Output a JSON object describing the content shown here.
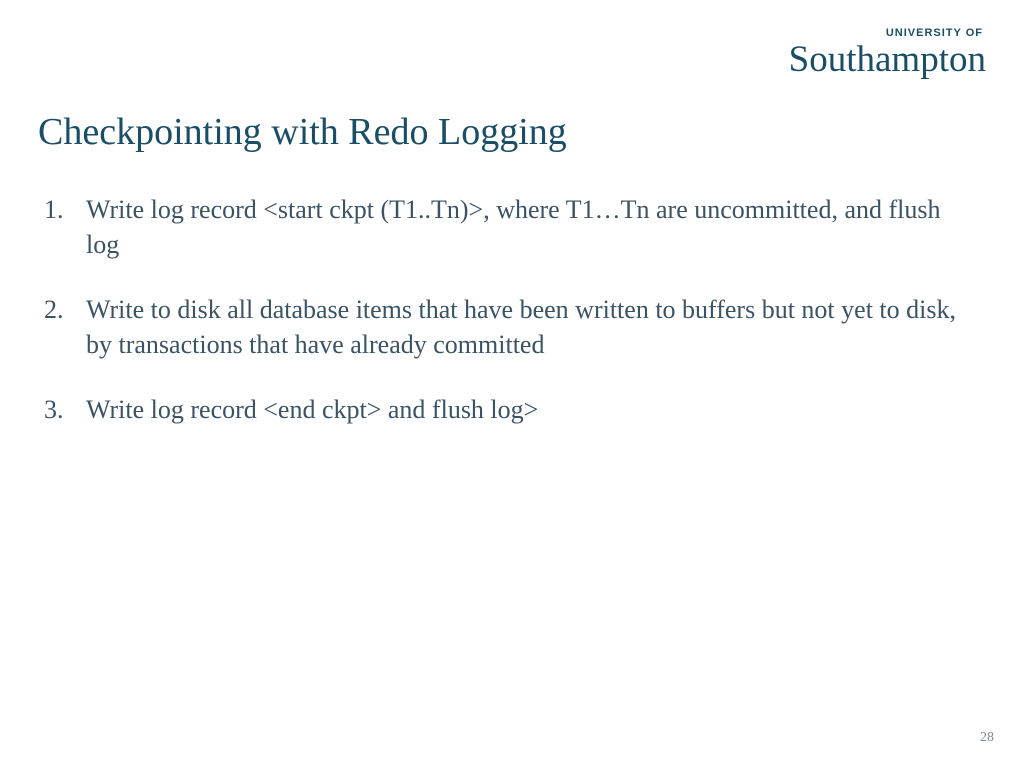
{
  "logo": {
    "tagline": "UNIVERSITY OF",
    "name": "Southampton"
  },
  "title": "Checkpointing with Redo Logging",
  "items": [
    "Write log record <start ckpt (T1..Tn)>, where T1…Tn are uncommitted, and flush log",
    "Write to disk all database items that have been written to buffers but not yet to disk, by transactions that have already committed",
    "Write log record <end ckpt> and flush log>"
  ],
  "pageNumber": "28"
}
